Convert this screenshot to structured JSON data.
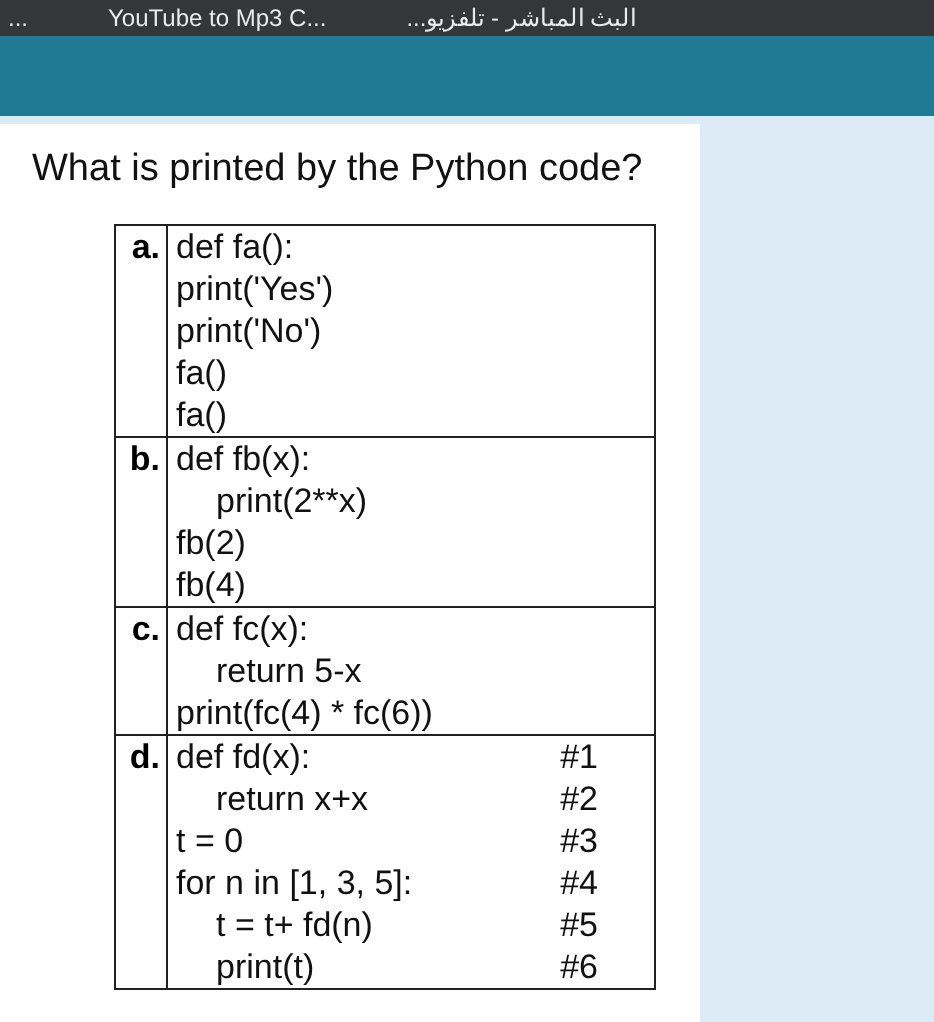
{
  "bookmarks_bar": {
    "items": [
      {
        "label": "..."
      },
      {
        "label": "YouTube to Mp3 C..."
      },
      {
        "label": "...البث المباشر - تلفزيو"
      }
    ]
  },
  "question": {
    "prompt": "What is printed by the Python code?",
    "options": [
      {
        "label": "a.",
        "lines": [
          {
            "text": "def fa():"
          },
          {
            "text": "print('Yes')"
          },
          {
            "text": "print('No')"
          },
          {
            "text": "fa()"
          },
          {
            "text": "fa()"
          }
        ]
      },
      {
        "label": "b.",
        "lines": [
          {
            "text": "def fb(x):",
            "children": [
              {
                "text": "print(2**x)"
              }
            ]
          },
          {
            "text": "fb(2)"
          },
          {
            "text": "fb(4)"
          }
        ]
      },
      {
        "label": "c.",
        "lines": [
          {
            "text": "def fc(x):",
            "children": [
              {
                "text": "return 5-x"
              }
            ]
          },
          {
            "text": "print(fc(4) * fc(6))"
          }
        ]
      },
      {
        "label": "d.",
        "lines": [
          {
            "text": "def fd(x):",
            "comment": "#1",
            "children": [
              {
                "text": "return x+x",
                "comment": "#2"
              }
            ]
          },
          {
            "text": "t = 0",
            "comment": "#3"
          },
          {
            "text": "for n in [1, 3, 5]:",
            "comment": "#4",
            "children": [
              {
                "text": "t = t+ fd(n)",
                "comment": "#5"
              },
              {
                "text": "print(t)",
                "comment": "#6"
              }
            ]
          }
        ]
      }
    ]
  }
}
